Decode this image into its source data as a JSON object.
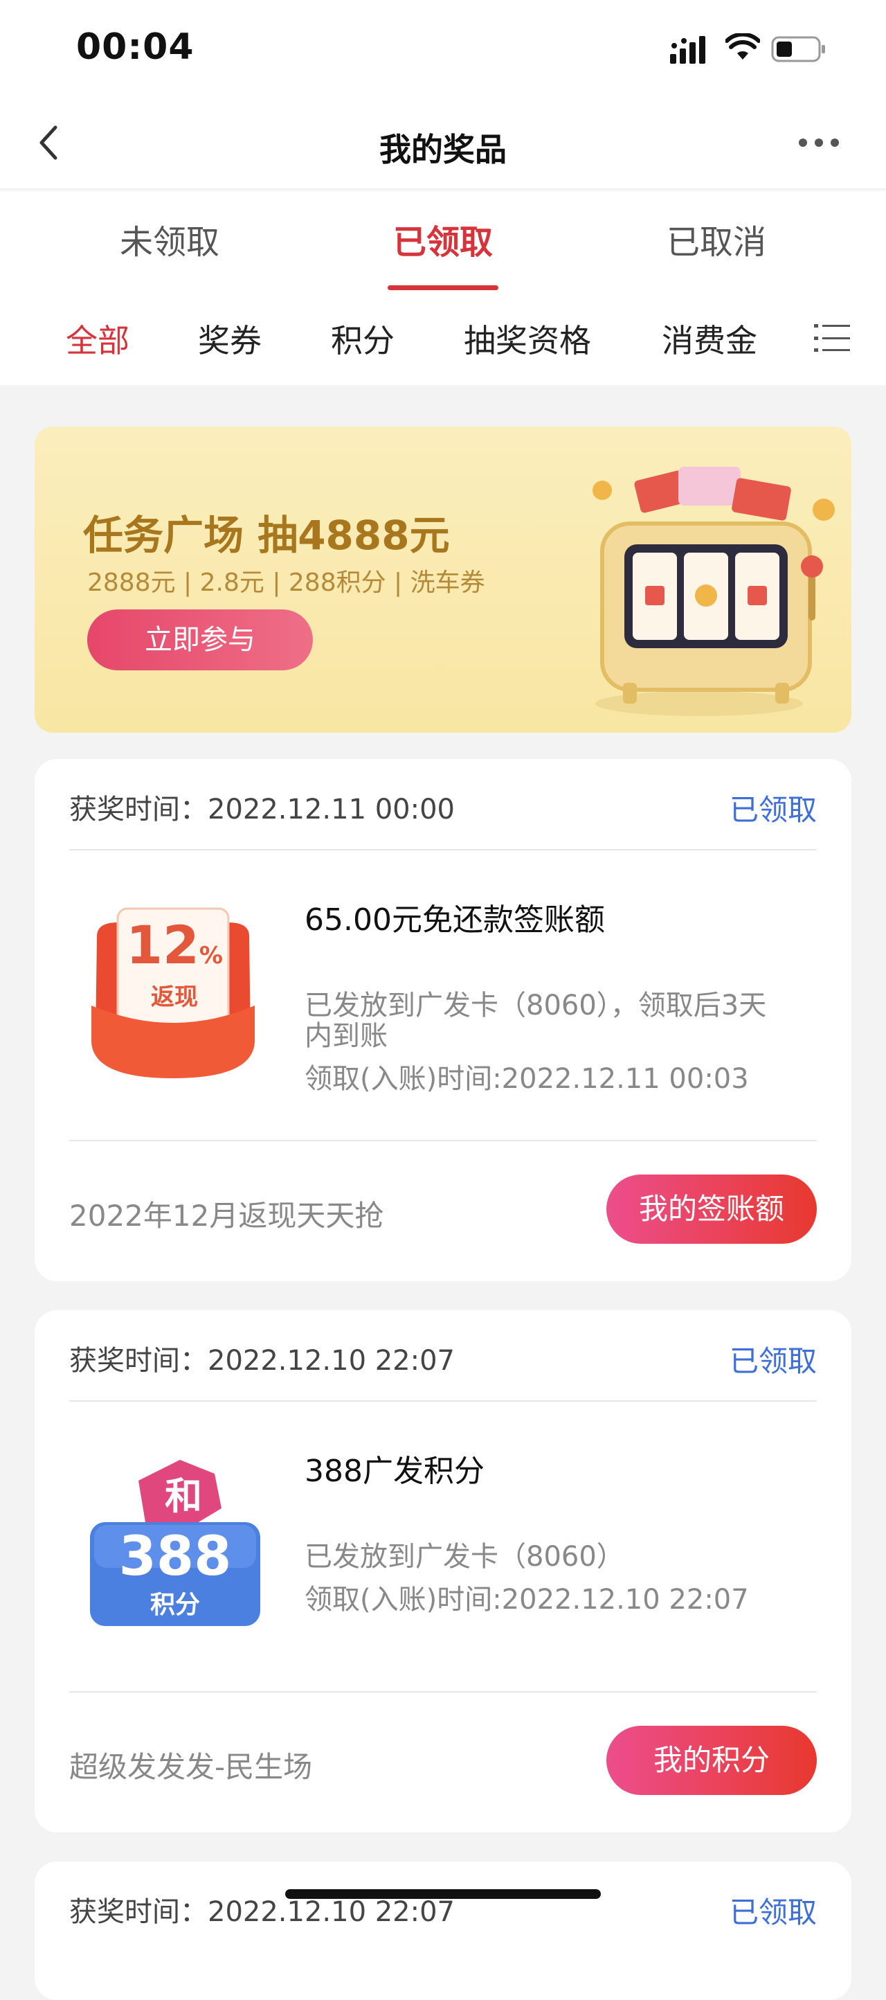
{
  "status_bar": {
    "time": "00:04"
  },
  "nav": {
    "title": "我的奖品"
  },
  "tabs": [
    {
      "label": "未领取"
    },
    {
      "label": "已领取"
    },
    {
      "label": "已取消"
    }
  ],
  "filters": [
    {
      "label": "全部"
    },
    {
      "label": "奖券"
    },
    {
      "label": "积分"
    },
    {
      "label": "抽奖资格"
    },
    {
      "label": "消费金"
    }
  ],
  "banner": {
    "title": "任务广场 抽4888元",
    "subtitle": "2888元 | 2.8元 | 288积分 | 洗车券",
    "button": "立即参与"
  },
  "cards": [
    {
      "time_label": "获奖时间：2022.12.11 00:00",
      "status": "已领取",
      "badge_value": "12",
      "badge_unit": "%",
      "badge_caption": "返现",
      "title": "65.00元免还款签账额",
      "desc": "已发放到广发卡（8060），领取后3天内到账",
      "claim_time": "领取(入账)时间:2022.12.11 00:03",
      "footer": "2022年12月返现天天抢",
      "button": "我的签账额"
    },
    {
      "time_label": "获奖时间：2022.12.10 22:07",
      "status": "已领取",
      "badge_top": "和",
      "badge_value": "388",
      "badge_caption": "积分",
      "title": "388广发积分",
      "desc": "已发放到广发卡（8060）",
      "claim_time": "领取(入账)时间:2022.12.10 22:07",
      "footer": "超级发发发-民生场",
      "button": "我的积分"
    },
    {
      "time_label": "获奖时间：2022.12.10 22:07",
      "status": "已领取"
    }
  ]
}
